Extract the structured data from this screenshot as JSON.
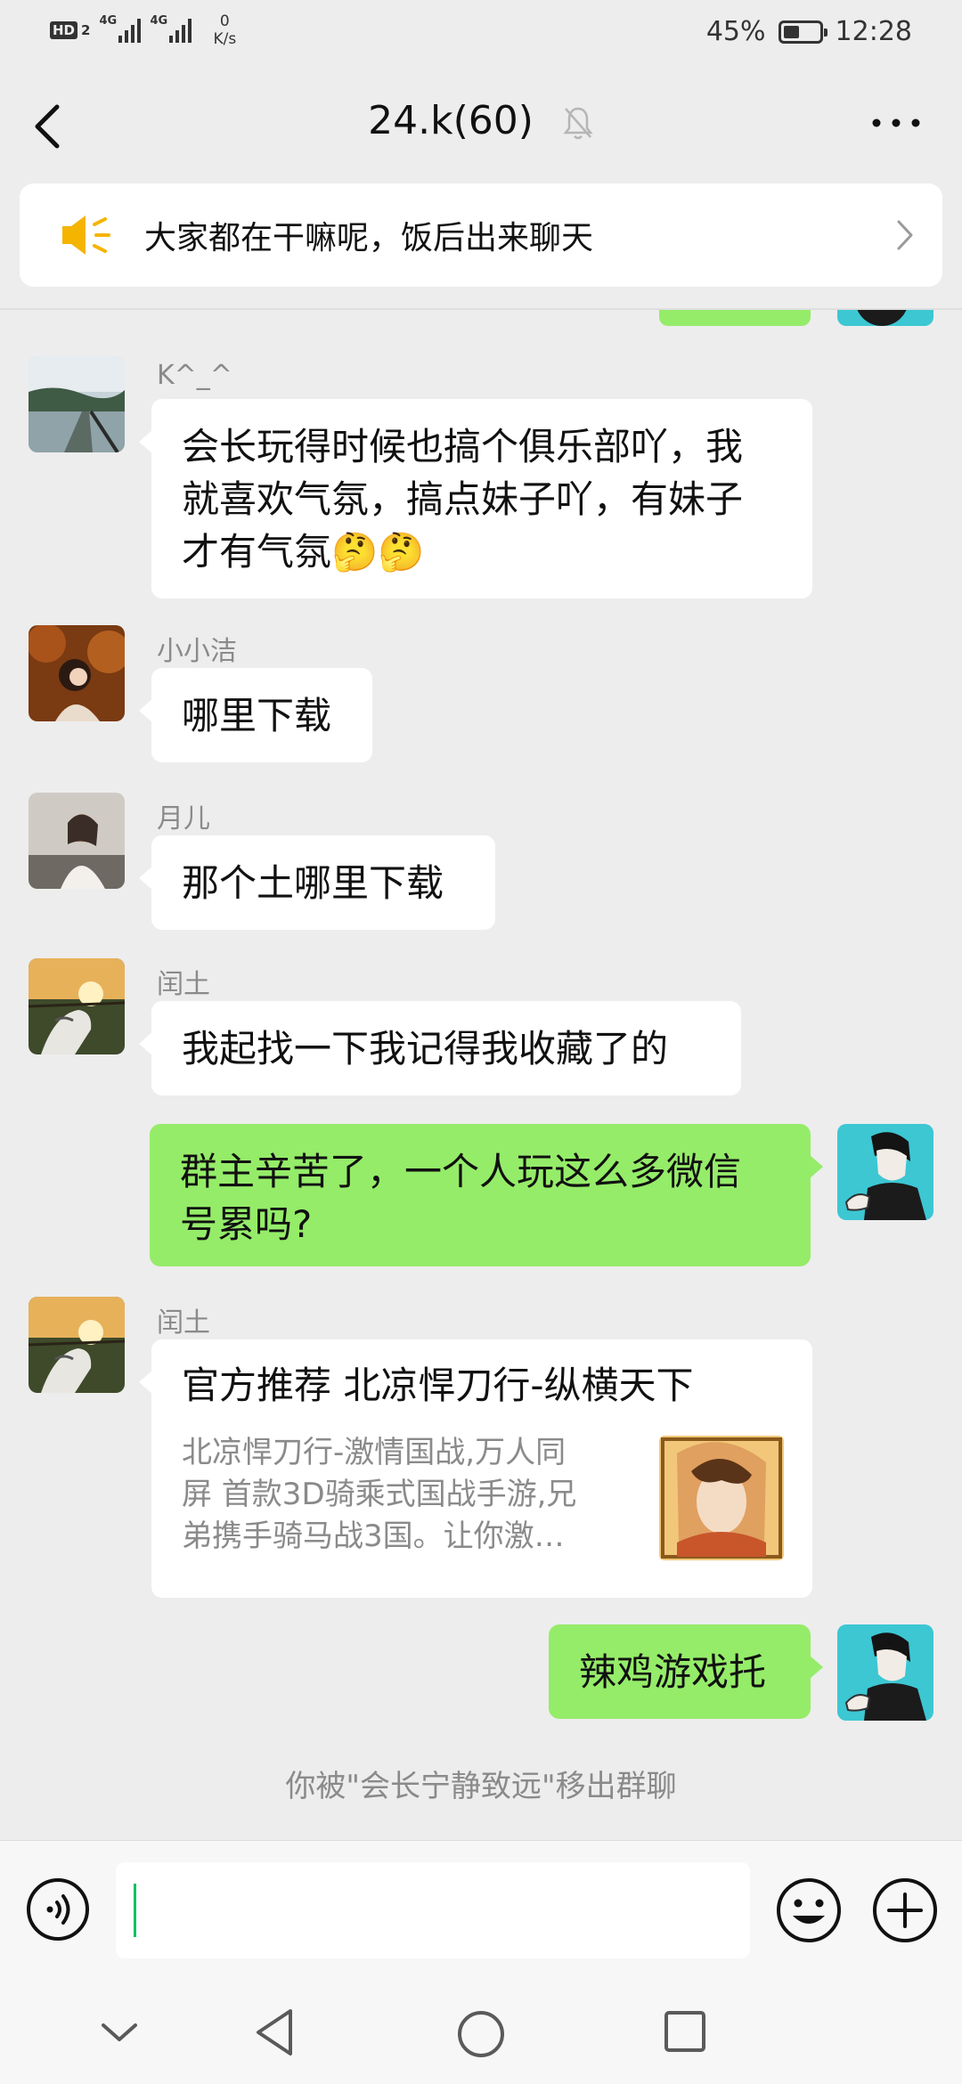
{
  "status_bar": {
    "hd_label": "HD",
    "hd_sim": "2",
    "sim1_label": "4G",
    "sim2_label": "4G",
    "speed_value": "0",
    "speed_unit": "K/s",
    "battery_percent": "45%",
    "battery_level": 0.45,
    "time": "12:28"
  },
  "nav": {
    "title": "24.k(60)",
    "icons": [
      "back-arrow",
      "bell-muted",
      "more-dots"
    ]
  },
  "announcement": {
    "text": "大家都在干嘛呢，饭后出来聊天",
    "icon": "megaphone"
  },
  "messages": [
    {
      "sender": "K^_^",
      "side": "left",
      "lines": [
        "会长玩得时候也搞个俱乐部吖，我",
        "就喜欢气氛，搞点妹子吖，有妹子",
        "才有气氛🤔🤔"
      ]
    },
    {
      "sender": "小小洁",
      "side": "left",
      "lines": [
        "哪里下载"
      ]
    },
    {
      "sender": "月儿",
      "side": "left",
      "lines": [
        "那个土哪里下载"
      ]
    },
    {
      "sender": "闰土",
      "side": "left",
      "lines": [
        "我起找一下我记得我收藏了的"
      ]
    },
    {
      "sender": "",
      "side": "right",
      "lines": [
        "群主辛苦了，一个人玩这么多微信",
        "号累吗?"
      ]
    },
    {
      "sender": "闰土",
      "side": "left",
      "card": {
        "title": "官方推荐 北凉悍刀行-纵横天下",
        "desc_lines": [
          "北凉悍刀行-激情国战,万人同",
          "屏 首款3D骑乘式国战手游,兄",
          "弟携手骑马战3国。让你激…"
        ]
      }
    },
    {
      "sender": "",
      "side": "right",
      "lines": [
        "辣鸡游戏托"
      ]
    }
  ],
  "system_message": "你被\"会长宁静致远\"移出群聊",
  "input_bar": {
    "value": "",
    "icons": [
      "voice",
      "emoji",
      "plus"
    ]
  },
  "system_nav": {
    "icons": [
      "collapse-chevron",
      "back-triangle",
      "home-circle",
      "recents-square"
    ]
  },
  "colors": {
    "background": "#ededed",
    "own_bubble": "#95ec69",
    "other_bubble": "#ffffff",
    "accent": "#07c160",
    "megaphone": "#f5b400"
  }
}
